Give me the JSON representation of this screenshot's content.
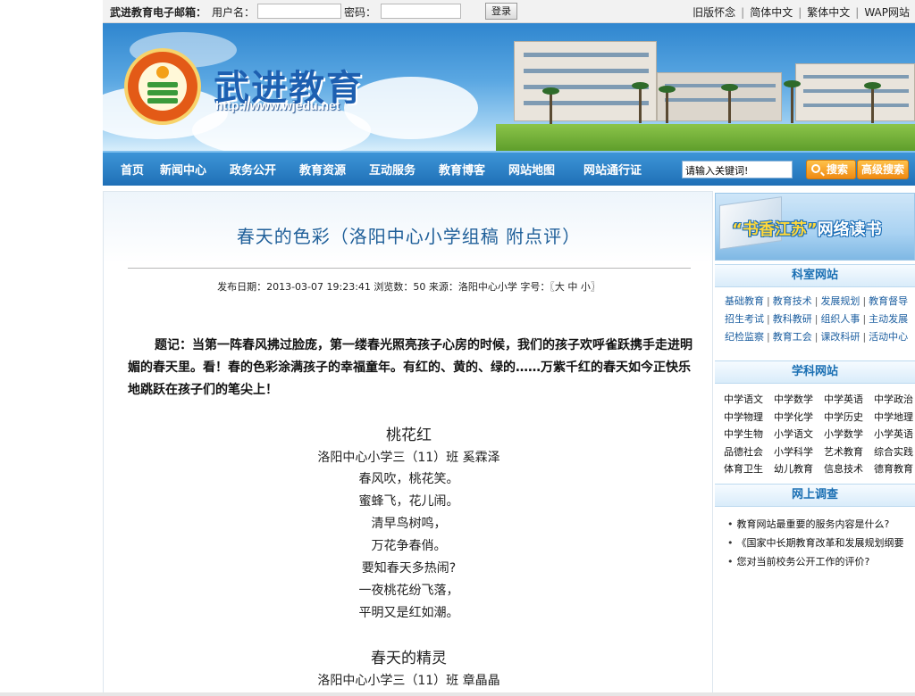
{
  "topbar": {
    "mail_title": "武进教育电子邮箱：",
    "username_label": "用户名：",
    "password_label": "密码：",
    "login_button": "登录",
    "links": [
      "旧版怀念",
      "简体中文",
      "繁体中文",
      "WAP网站"
    ]
  },
  "banner": {
    "site_title": "武进教育",
    "site_url": "http://www.wjedu.net"
  },
  "nav": {
    "items": [
      "首页",
      "新闻中心",
      "政务公开",
      "教育资源",
      "互动服务",
      "教育博客",
      "网站地图",
      "网站通行证"
    ],
    "search_value": "请输入关键词!",
    "search_button": "搜索",
    "advanced_search_button": "高级搜索"
  },
  "article": {
    "title": "春天的色彩（洛阳中心小学组稿  附点评）",
    "meta": "发布日期：2013-03-07 19:23:41 浏览数：50 来源：洛阳中心小学 字号：〖大 中 小〗",
    "intro": "题记：当第一阵春风拂过脸庞，第一缕春光照亮孩子心房的时候，我们的孩子欢呼雀跃携手走进明媚的春天里。看！春的色彩涂满孩子的幸福童年。有红的、黄的、绿的……万紫千红的春天如今正快乐地跳跃在孩子们的笔尖上！",
    "poems": [
      {
        "title": "桃花红",
        "author": "洛阳中心小学三（11）班 奚霖泽",
        "lines": [
          "春风吹，桃花笑。",
          "蜜蜂飞，花儿闹。",
          "清早鸟树鸣，",
          "万花争春俏。",
          "要知春天多热闹?",
          "一夜桃花纷飞落，",
          "平明又是红如潮。"
        ]
      },
      {
        "title": "春天的精灵",
        "author": "洛阳中心小学三（11）班 章晶晶",
        "lines": []
      }
    ]
  },
  "sidebar": {
    "promo_text_1": "“书香江苏”",
    "promo_text_2": "网络读书",
    "keshi_title": "科室网站",
    "keshi_rows": [
      [
        "基础教育",
        "教育技术",
        "发展规划",
        "教育督导"
      ],
      [
        "招生考试",
        "教科教研",
        "组织人事",
        "主动发展"
      ],
      [
        "纪检监察",
        "教育工会",
        "课改科研",
        "活动中心"
      ]
    ],
    "xueke_title": "学科网站",
    "xueke_rows": [
      [
        "中学语文",
        "中学数学",
        "中学英语",
        "中学政治"
      ],
      [
        "中学物理",
        "中学化学",
        "中学历史",
        "中学地理"
      ],
      [
        "中学生物",
        "小学语文",
        "小学数学",
        "小学英语"
      ],
      [
        "品德社会",
        "小学科学",
        "艺术教育",
        "综合实践"
      ],
      [
        "体育卫生",
        "幼儿教育",
        "信息技术",
        "德育教育"
      ]
    ],
    "survey_title": "网上调查",
    "survey_items": [
      "教育网站最重要的服务内容是什么?",
      "《国家中长期教育改革和发展规划纲要",
      "您对当前校务公开工作的评价?"
    ]
  }
}
